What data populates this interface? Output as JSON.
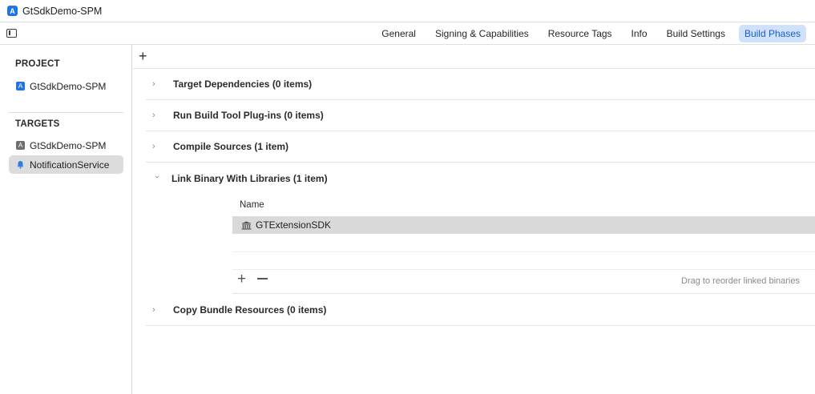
{
  "window": {
    "title": "GtSdkDemo-SPM"
  },
  "tabs": [
    "General",
    "Signing & Capabilities",
    "Resource Tags",
    "Info",
    "Build Settings",
    "Build Phases"
  ],
  "active_tab": "Build Phases",
  "sidebar": {
    "project_heading": "PROJECT",
    "project_item": "GtSdkDemo-SPM",
    "targets_heading": "TARGETS",
    "targets": [
      "GtSdkDemo-SPM",
      "NotificationService"
    ],
    "selected_target": "NotificationService"
  },
  "phases": [
    {
      "title": "Target Dependencies (0 items)",
      "expanded": false
    },
    {
      "title": "Run Build Tool Plug-ins (0 items)",
      "expanded": false
    },
    {
      "title": "Compile Sources (1 item)",
      "expanded": false
    },
    {
      "title": "Link Binary With Libraries (1 item)",
      "expanded": true
    },
    {
      "title": "Copy Bundle Resources (0 items)",
      "expanded": false
    }
  ],
  "link_libraries": {
    "column_header": "Name",
    "items": [
      "GTExtensionSDK"
    ],
    "footer_note": "Drag to reorder linked binaries"
  },
  "icons": {
    "app": "xcode-app-icon",
    "target_app": "app-target-icon",
    "target_ext": "notification-bell-icon",
    "library": "library-building-icon"
  },
  "colors": {
    "accent": "#1a5fc9",
    "accent_bg": "#cfe1fb",
    "selection": "#dadada"
  }
}
